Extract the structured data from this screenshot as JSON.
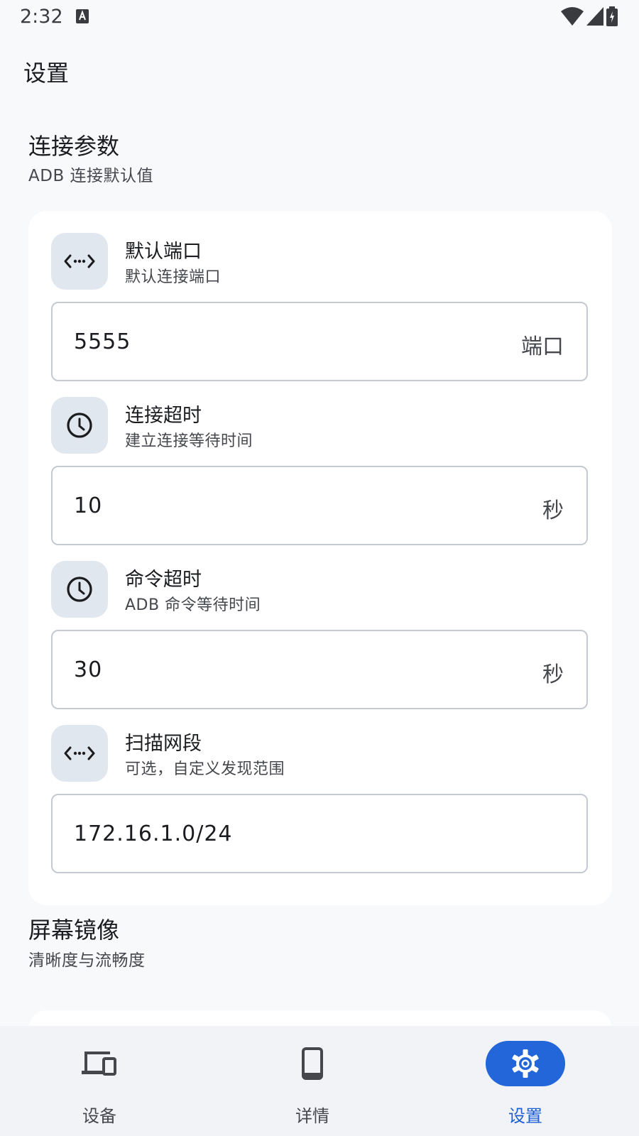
{
  "status_bar": {
    "time": "2:32"
  },
  "app": {
    "title": "设置"
  },
  "connection": {
    "title": "连接参数",
    "subtitle": "ADB 连接默认值",
    "rows": [
      {
        "icon": "code-arrows-icon",
        "label": "默认端口",
        "desc": "默认连接端口",
        "value": "5555",
        "suffix": "端口"
      },
      {
        "icon": "clock-icon",
        "label": "连接超时",
        "desc": "建立连接等待时间",
        "value": "10",
        "suffix": "秒"
      },
      {
        "icon": "clock-icon",
        "label": "命令超时",
        "desc": "ADB 命令等待时间",
        "value": "30",
        "suffix": "秒"
      },
      {
        "icon": "code-arrows-icon",
        "label": "扫描网段",
        "desc": "可选，自定义发现范围",
        "value": "172.16.1.0/24",
        "suffix": ""
      }
    ]
  },
  "mirroring": {
    "title": "屏幕镜像",
    "subtitle": "清晰度与流畅度"
  },
  "nav": {
    "items": [
      {
        "label": "设备",
        "icon": "devices-icon",
        "active": false
      },
      {
        "label": "详情",
        "icon": "phone-icon",
        "active": false
      },
      {
        "label": "设置",
        "icon": "gear-icon",
        "active": true
      }
    ]
  },
  "colors": {
    "accent": "#2266d9",
    "icon_bg": "#e1e7ef",
    "background": "#f8f9fb"
  }
}
